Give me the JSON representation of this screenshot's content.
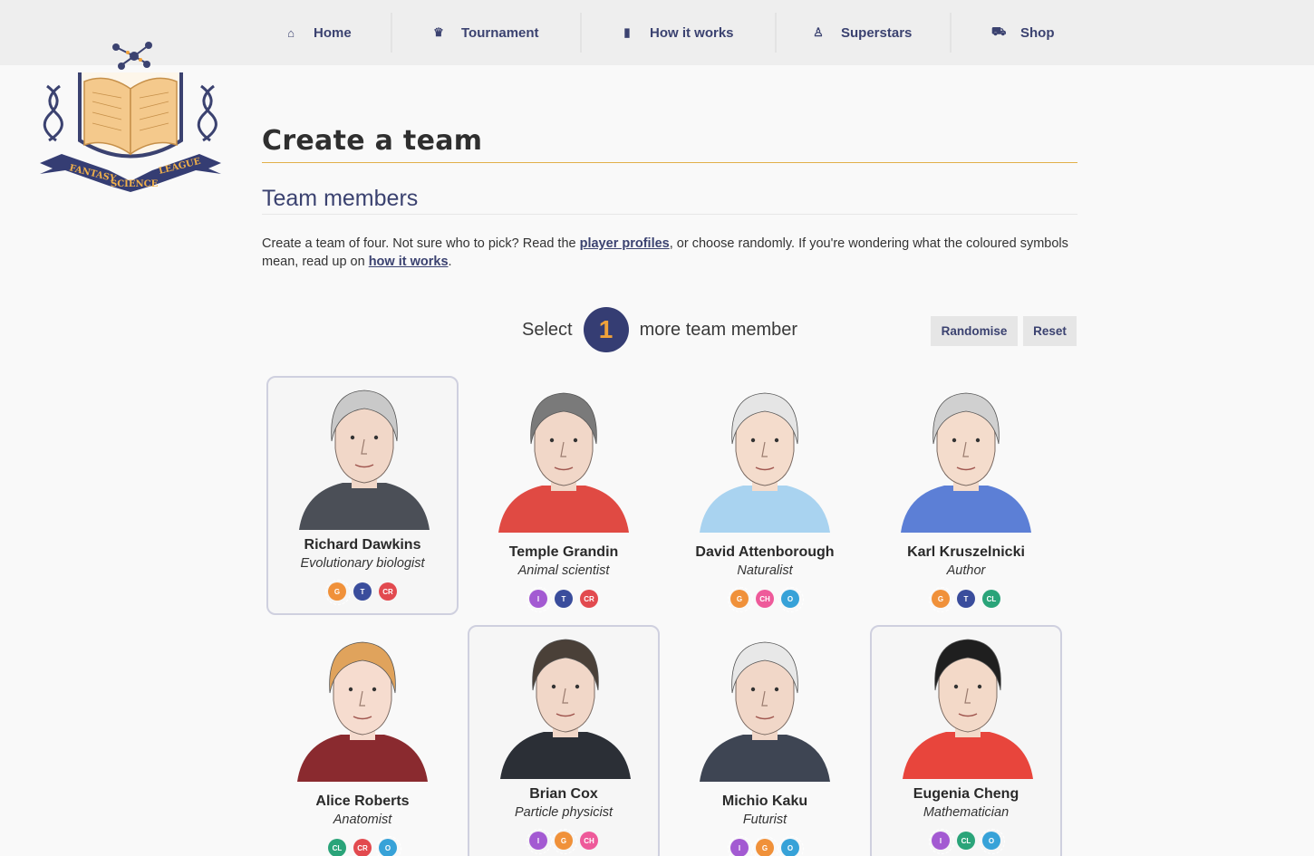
{
  "nav": {
    "items": [
      {
        "label": "Home",
        "icon": "home-icon",
        "glyph": "⌂"
      },
      {
        "label": "Tournament",
        "icon": "trophy-icon",
        "glyph": "♛"
      },
      {
        "label": "How it works",
        "icon": "book-icon",
        "glyph": "▮"
      },
      {
        "label": "Superstars",
        "icon": "person-icon",
        "glyph": "♙"
      },
      {
        "label": "Shop",
        "icon": "cart-icon",
        "glyph": "⛟"
      }
    ]
  },
  "logo": {
    "left": "FANTASY",
    "center": "SCIENCE",
    "right": "LEAGUE"
  },
  "page": {
    "title": "Create a team",
    "subtitle": "Team members",
    "intro": {
      "part1": "Create a team of four. Not sure who to pick? Read the ",
      "link1": "player profiles",
      "part2": ", or choose randomly. If you're wondering what the coloured symbols mean, read up on ",
      "link2": "how it works",
      "part3": "."
    },
    "select_prefix": "Select",
    "select_count": "1",
    "select_suffix": "more team member",
    "randomise_label": "Randomise",
    "reset_label": "Reset"
  },
  "colors": {
    "G": "#f0913a",
    "T": "#3a4d9c",
    "CR": "#e24a4f",
    "I": "#a35ad2",
    "CH": "#ee5a9a",
    "O": "#37a2d8",
    "CL": "#2aa479"
  },
  "players": [
    {
      "name": "Richard Dawkins",
      "role": "Evolutionary biologist",
      "selected": true,
      "badges": [
        "G",
        "T",
        "CR"
      ],
      "hair": "#c9c9c9",
      "shirt": "#4b4f57",
      "skin": "#f1d7c8"
    },
    {
      "name": "Temple Grandin",
      "role": "Animal scientist",
      "selected": false,
      "badges": [
        "I",
        "T",
        "CR"
      ],
      "hair": "#7a7a7a",
      "shirt": "#e04a43",
      "skin": "#f1d7c8"
    },
    {
      "name": "David Attenborough",
      "role": "Naturalist",
      "selected": false,
      "badges": [
        "G",
        "CH",
        "O"
      ],
      "hair": "#e5e5e5",
      "shirt": "#a9d3f0",
      "skin": "#f4dccc"
    },
    {
      "name": "Karl Kruszelnicki",
      "role": "Author",
      "selected": false,
      "badges": [
        "G",
        "T",
        "CL"
      ],
      "hair": "#d0d0d0",
      "shirt": "#5c7fd6",
      "skin": "#f4dccc"
    },
    {
      "name": "Alice Roberts",
      "role": "Anatomist",
      "selected": false,
      "badges": [
        "CL",
        "CR",
        "O"
      ],
      "hair": "#e0a35c",
      "shirt": "#8a2a2f",
      "skin": "#f6dccf"
    },
    {
      "name": "Brian Cox",
      "role": "Particle physicist",
      "selected": true,
      "badges": [
        "I",
        "G",
        "CH"
      ],
      "hair": "#4a4038",
      "shirt": "#2b2f36",
      "skin": "#f1d7c8"
    },
    {
      "name": "Michio Kaku",
      "role": "Futurist",
      "selected": false,
      "badges": [
        "I",
        "G",
        "O"
      ],
      "hair": "#e8e8e8",
      "shirt": "#3e4553",
      "skin": "#f1d7c8"
    },
    {
      "name": "Eugenia Cheng",
      "role": "Mathematician",
      "selected": true,
      "badges": [
        "I",
        "CL",
        "O"
      ],
      "hair": "#1f1f1f",
      "shirt": "#e8453c",
      "skin": "#f3d9c8"
    }
  ]
}
